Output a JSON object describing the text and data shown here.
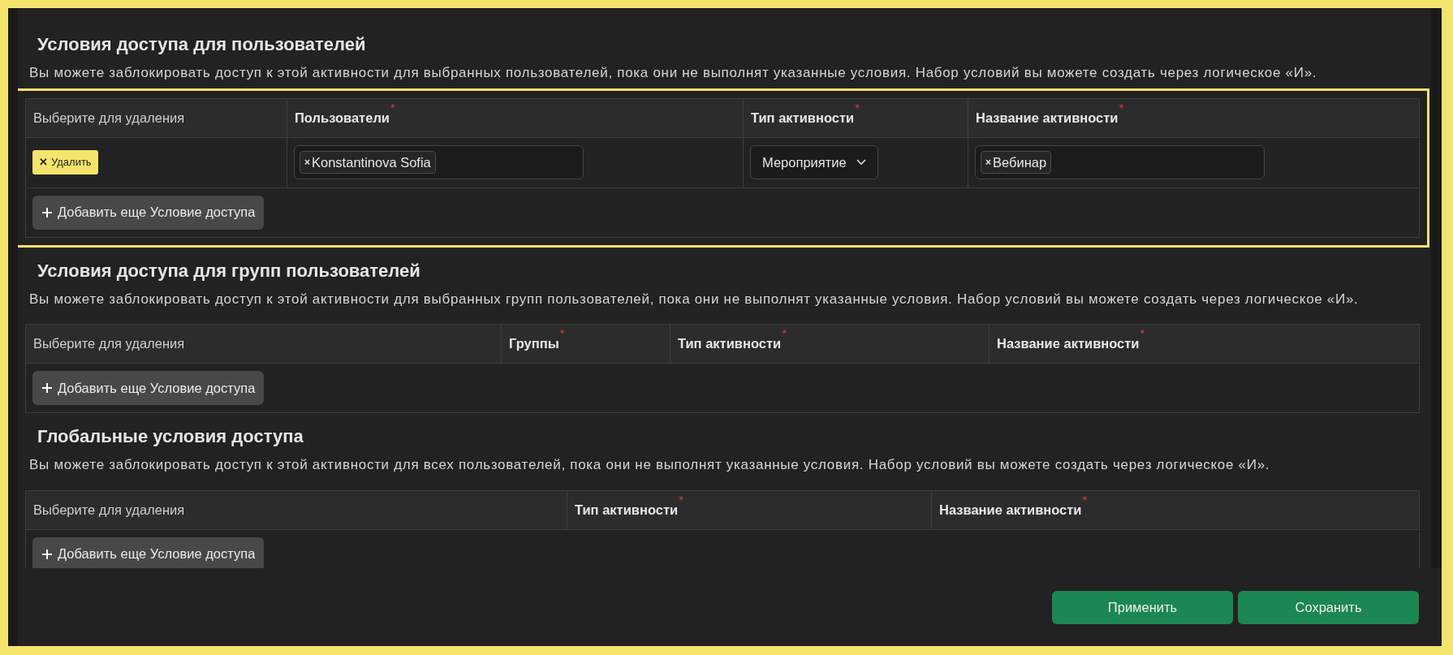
{
  "sections": [
    {
      "title": "Условия доступа для пользователей",
      "description": "Вы можете заблокировать доступ к этой активности для выбранных пользователей, пока они не выполнят указанные условия. Набор условий вы можете создать через логическое «И».",
      "highlighted": true,
      "columns": [
        {
          "label": "Выберите для удаления"
        },
        {
          "label": "Пользователи",
          "required_mark": "*"
        },
        {
          "label": "Тип активности",
          "required_mark": "*"
        },
        {
          "label": "Название активности",
          "required_mark": "*"
        }
      ],
      "rows": [
        {
          "cells": [
            {
              "kind": "delete",
              "icon": "✕",
              "label": "Удалить"
            },
            {
              "kind": "tags",
              "tags": [
                {
                  "remove": "×",
                  "label": "Konstantinova Sofia"
                }
              ]
            },
            {
              "kind": "select",
              "value": "Мероприятие"
            },
            {
              "kind": "tags",
              "tags": [
                {
                  "remove": "×",
                  "label": "Вебинар"
                }
              ]
            }
          ]
        }
      ],
      "add_button": "Добавить еще Условие доступа"
    },
    {
      "title": "Условия доступа для групп пользователей",
      "description": "Вы можете заблокировать доступ к этой активности для выбранных групп пользователей, пока они не выполнят указанные условия. Набор условий вы можете создать через логическое «И».",
      "highlighted": false,
      "columns": [
        {
          "label": "Выберите для удаления"
        },
        {
          "label": "Группы",
          "required_mark": "*"
        },
        {
          "label": "Тип активности",
          "required_mark": "*"
        },
        {
          "label": "Название активности",
          "required_mark": "*"
        }
      ],
      "add_button": "Добавить еще Условие доступа"
    },
    {
      "title": "Глобальные условия доступа",
      "description": "Вы можете заблокировать доступ к этой активности для всех пользователей, пока они не выполнят указанные условия. Набор условий вы можете создать через логическое «И».",
      "highlighted": false,
      "columns": [
        {
          "label": "Выберите для удаления"
        },
        {
          "label": "Тип активности",
          "required_mark": "*"
        },
        {
          "label": "Название активности",
          "required_mark": "*"
        }
      ],
      "add_button": "Добавить еще Условие доступа"
    }
  ],
  "footer": {
    "buttons": [
      "Применить",
      "Сохранить"
    ]
  }
}
